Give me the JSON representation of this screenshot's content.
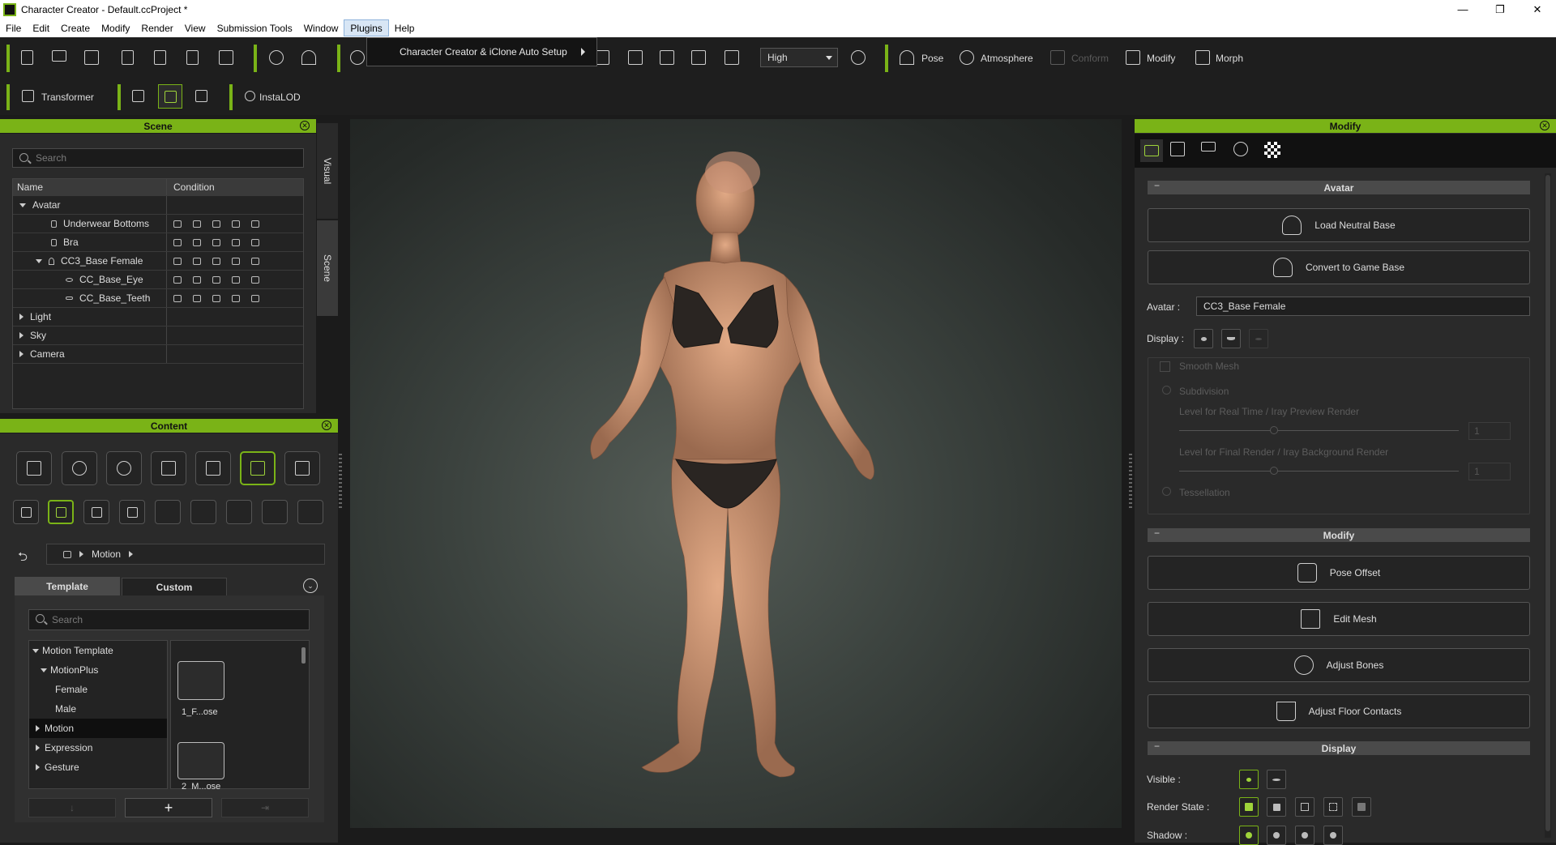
{
  "window": {
    "title": "Character Creator - Default.ccProject *",
    "controls": [
      "—",
      "❐",
      "✕"
    ]
  },
  "menu": [
    "File",
    "Edit",
    "Create",
    "Modify",
    "Render",
    "View",
    "Submission Tools",
    "Window",
    "Plugins",
    "Help"
  ],
  "plugins_dropdown": {
    "item": "Character Creator & iClone Auto Setup"
  },
  "toolbar": {
    "quality": "High",
    "pose": "Pose",
    "atmosphere": "Atmosphere",
    "conform": "Conform",
    "modify": "Modify",
    "morph": "Morph",
    "transformer": "Transformer",
    "instalod": "InstaLOD"
  },
  "scene": {
    "title": "Scene",
    "search_placeholder": "Search",
    "col_name": "Name",
    "col_condition": "Condition",
    "items": [
      {
        "label": "Avatar"
      },
      {
        "label": "Underwear Bottoms"
      },
      {
        "label": "Bra"
      },
      {
        "label": "CC3_Base Female"
      },
      {
        "label": "CC_Base_Eye"
      },
      {
        "label": "CC_Base_Teeth"
      },
      {
        "label": "Light"
      },
      {
        "label": "Sky"
      },
      {
        "label": "Camera"
      }
    ],
    "side_tabs": [
      "Visual",
      "Scene"
    ]
  },
  "content": {
    "title": "Content",
    "breadcrumb": "Motion",
    "tab_template": "Template",
    "tab_custom": "Custom",
    "search_placeholder": "Search",
    "tree": [
      "Motion Template",
      "MotionPlus",
      "Female",
      "Male",
      "Motion",
      "Expression",
      "Gesture"
    ],
    "thumbs": [
      "1_F...ose",
      "2_M...ose"
    ]
  },
  "modify": {
    "title": "Modify",
    "section_avatar": "Avatar",
    "load_neutral": "Load Neutral Base",
    "convert_game": "Convert to Game Base",
    "avatar_label": "Avatar :",
    "avatar_value": "CC3_Base Female",
    "display_label": "Display :",
    "smooth_mesh": "Smooth Mesh",
    "subdivision": "Subdivision",
    "level_realtime": "Level for Real Time / Iray Preview Render",
    "level_final": "Level for Final Render / Iray Background Render",
    "spin1": "1",
    "spin2": "1",
    "tessellation": "Tessellation",
    "section_modify": "Modify",
    "pose_offset": "Pose Offset",
    "edit_mesh": "Edit Mesh",
    "adjust_bones": "Adjust Bones",
    "adjust_floor": "Adjust Floor Contacts",
    "section_display": "Display",
    "visible_label": "Visible :",
    "render_state_label": "Render State :",
    "shadow_label": "Shadow :"
  },
  "colors": {
    "accent": "#7ab317",
    "panel": "#2a2a2a",
    "background": "#1b1b1b"
  }
}
